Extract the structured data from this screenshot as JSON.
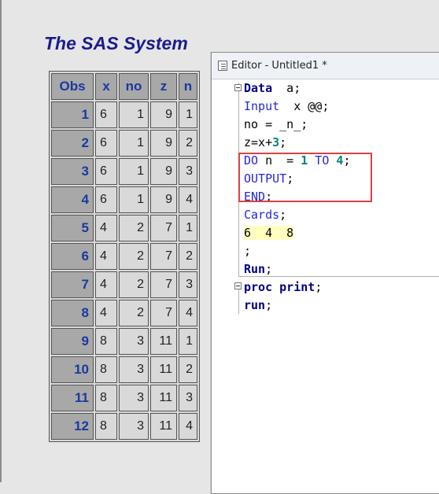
{
  "results": {
    "title": "The SAS System",
    "headers": [
      "Obs",
      "x",
      "no",
      "z",
      "n"
    ],
    "rows": [
      {
        "obs": "1",
        "x": "6",
        "no": "1",
        "z": "9",
        "n": "1"
      },
      {
        "obs": "2",
        "x": "6",
        "no": "1",
        "z": "9",
        "n": "2"
      },
      {
        "obs": "3",
        "x": "6",
        "no": "1",
        "z": "9",
        "n": "3"
      },
      {
        "obs": "4",
        "x": "6",
        "no": "1",
        "z": "9",
        "n": "4"
      },
      {
        "obs": "5",
        "x": "4",
        "no": "2",
        "z": "7",
        "n": "1"
      },
      {
        "obs": "6",
        "x": "4",
        "no": "2",
        "z": "7",
        "n": "2"
      },
      {
        "obs": "7",
        "x": "4",
        "no": "2",
        "z": "7",
        "n": "3"
      },
      {
        "obs": "8",
        "x": "4",
        "no": "2",
        "z": "7",
        "n": "4"
      },
      {
        "obs": "9",
        "x": "8",
        "no": "3",
        "z": "11",
        "n": "1"
      },
      {
        "obs": "10",
        "x": "8",
        "no": "3",
        "z": "11",
        "n": "2"
      },
      {
        "obs": "11",
        "x": "8",
        "no": "3",
        "z": "11",
        "n": "3"
      },
      {
        "obs": "12",
        "x": "8",
        "no": "3",
        "z": "11",
        "n": "4"
      }
    ]
  },
  "editor": {
    "title": "Editor - Untitled1 *",
    "code": {
      "l1_kw": "Data",
      "l1_rest": "  a;",
      "l2_kw": "Input",
      "l2_rest": "  x @@;",
      "l3": "no = _n_;",
      "l4_a": "z=x+",
      "l4_num": "3",
      "l4_b": ";",
      "l5_kw": "DO",
      "l5_a": " n  = ",
      "l5_n1": "1",
      "l5_to": " TO ",
      "l5_n2": "4",
      "l5_b": ";",
      "l6_kw": "OUTPUT",
      "l6_b": ";",
      "l7_kw": "END",
      "l7_b": ";",
      "l8_kw": "Cards",
      "l8_b": ";",
      "l9": "6  4  8",
      "l10": ";",
      "l11_kw": "Run",
      "l11_b": ";",
      "l12_kw1": "proc",
      "l12_kw2": "print",
      "l12_b": ";",
      "l13_kw": "run",
      "l13_b": ";"
    }
  },
  "colors": {
    "title": "#1c1c8c",
    "header_text": "#1a3a9c",
    "keyword": "#000080",
    "blue_keyword": "#2626d9",
    "number": "#008080",
    "cards_bg": "#ffffc0",
    "highlight": "#e04040"
  },
  "icons": {
    "editor_icon": "document-icon",
    "fold_icon": "collapse-minus-icon"
  }
}
